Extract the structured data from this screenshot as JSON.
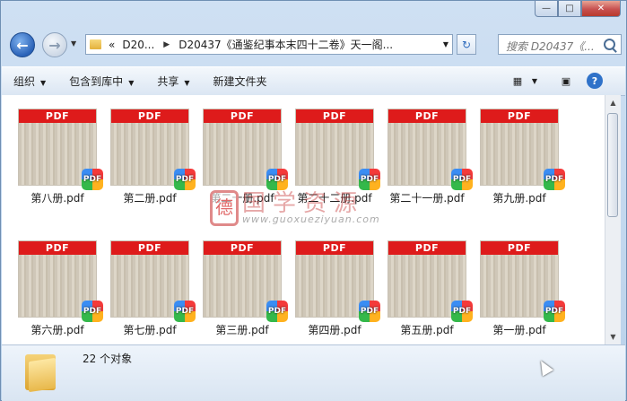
{
  "window": {
    "caption_buttons": {
      "minimize": "—",
      "maximize": "□",
      "close": "✕"
    }
  },
  "nav": {
    "back_glyph": "←",
    "forward_glyph": "→",
    "address": {
      "overflow": "«",
      "crumb1": "D20...",
      "crumb2": "D20437《通鉴纪事本末四十二卷》天一阁..."
    },
    "search_placeholder": "搜索 D20437《...",
    "refresh_glyph": "↻"
  },
  "toolbar": {
    "organize": "组织",
    "include_in_library": "包含到库中",
    "share": "共享",
    "new_folder": "新建文件夹"
  },
  "files": [
    {
      "name": "第八册.pdf"
    },
    {
      "name": "第二册.pdf"
    },
    {
      "name": "第二十册.pdf"
    },
    {
      "name": "第二十二册.pdf"
    },
    {
      "name": "第二十一册.pdf"
    },
    {
      "name": "第九册.pdf"
    },
    {
      "name": "第六册.pdf"
    },
    {
      "name": "第七册.pdf"
    },
    {
      "name": "第三册.pdf"
    },
    {
      "name": "第四册.pdf"
    },
    {
      "name": "第五册.pdf"
    },
    {
      "name": "第一册.pdf"
    }
  ],
  "thumb_band": "PDF",
  "badge_text": "PDF",
  "watermark": {
    "logo": "德",
    "text": "国学资源",
    "url": "www.guoxueziyuan.com"
  },
  "status": {
    "count": "22 个对象"
  },
  "colors": {
    "pdf_band": "#de1b1b",
    "accent": "#2a62b8"
  }
}
